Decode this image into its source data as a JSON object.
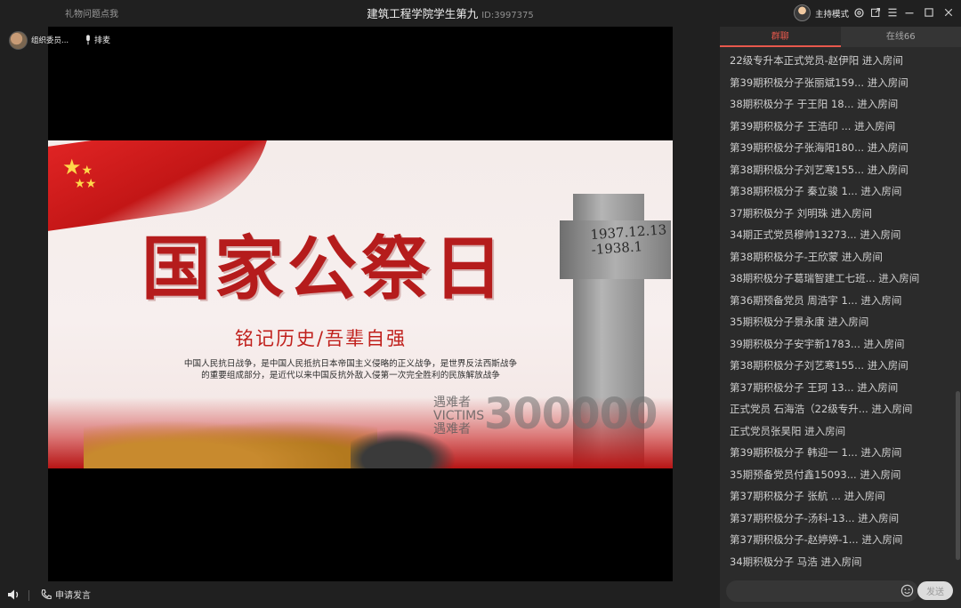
{
  "titlebar": {
    "help_link": "礼物问题点我",
    "room_title": "建筑工程学院学生第九",
    "room_id": "ID:3997375",
    "host_mode": "主持模式",
    "icons": [
      "settings-icon",
      "popout-icon",
      "menu-icon",
      "minimize-icon",
      "maximize-icon",
      "close-icon"
    ]
  },
  "presenter": {
    "name": "组织委员...",
    "mic_queue": "排麦"
  },
  "slide": {
    "headline": "国家公祭日",
    "subhead": "铭记历史/吾辈自强",
    "desc_line1": "中国人民抗日战争，是中国人民抵抗日本帝国主义侵略的正义战争，是世界反法西斯战争",
    "desc_line2": "的重要组成部分，是近代以来中国反抗外敌入侵第一次完全胜利的民族解放战争",
    "monument_date_1": "1937.12.13",
    "monument_date_2": "-1938.1",
    "victims_cn_1": "遇难者",
    "victims_en": "VICTIMS",
    "victims_cn_2": "遇难者",
    "victims_number": "300000",
    "colors": {
      "flag_red": "#d81e1e",
      "star_yellow": "#ffd84a",
      "headline_red": "#b51c1c"
    }
  },
  "bottombar": {
    "apply_speak": "申请发言",
    "icons": [
      "speaker-icon",
      "phone-icon"
    ]
  },
  "panel": {
    "tabs": [
      {
        "label": "群聊",
        "active": true
      },
      {
        "label": "在线66",
        "active": false
      }
    ],
    "messages": [
      "22级专升本正式党员-赵伊阳 进入房间",
      "第39期积极分子张丽斌159... 进入房间",
      "38期积极分子 于王阳 18... 进入房间",
      "第39期积极分子  王浩印 ... 进入房间",
      "第39期积极分子张海阳180... 进入房间",
      "第38期积极分子刘艺寒155... 进入房间",
      "第38期积极分子 秦立骏 1... 进入房间",
      "37期积极分子 刘明珠 进入房间",
      "34期正式党员穆帅13273... 进入房间",
      "第38期积极分子-王欣蒙 进入房间",
      "38期积极分子葛瑞智建工七班... 进入房间",
      "第36期预备党员 周浩宇 1... 进入房间",
      "35期积极分子景永康 进入房间",
      "39期积极分子安宇新1783... 进入房间",
      "第38期积极分子刘艺寒155... 进入房间",
      "第37期积极分子 王珂 13... 进入房间",
      "正式党员 石海浩（22级专升... 进入房间",
      "正式党员张昊阳 进入房间",
      "第39期积极分子 韩迎一 1... 进入房间",
      "35期预备党员付鑫15093... 进入房间",
      "第37期积极分子  张航  ... 进入房间",
      "第37期积极分子-汤科-13... 进入房间",
      "第37期积极分子-赵婷婷-1... 进入房间",
      "34期积极分子 马浩 进入房间"
    ],
    "chat_input_value": "",
    "send_label": "发送",
    "accent": "#e8584c"
  }
}
